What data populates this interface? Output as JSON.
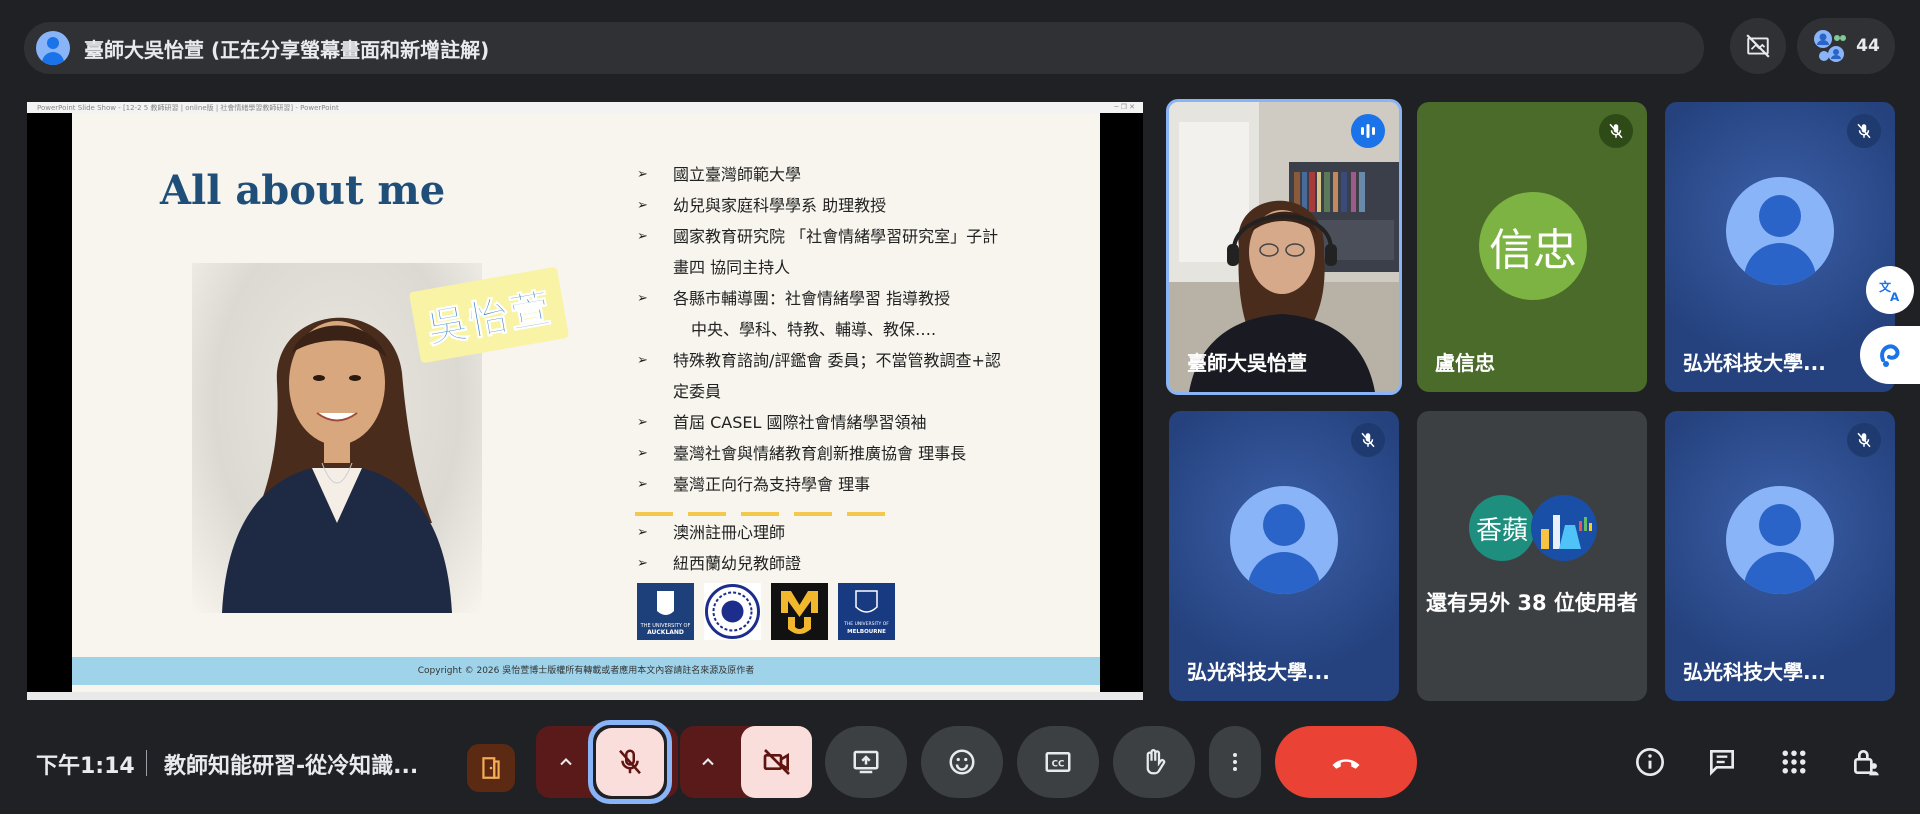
{
  "topbar": {
    "presenter_title": "臺師大吳怡萱 (正在分享螢幕畫面和新增註解)",
    "participant_count": "44"
  },
  "slide": {
    "window_title": "PowerPoint Slide Show - [12-2 5 教師研習 | online版 | 社會情緒學習教師研習] - PowerPoint",
    "heading": "All about me",
    "name_tag": "吳怡萱",
    "bullets": [
      "國立臺灣師範大學",
      "幼兒與家庭科學學系  助理教授",
      "國家教育研究院 「社會情緒學習研究室」子計",
      "畫四 協同主持人",
      "各縣市輔導團：社會情緒學習 指導教授",
      "中央、學科、特教、輔導、教保….",
      "特殊教育諮詢/評鑑會 委員；不當管教調查+認",
      "定委員",
      "首屆 CASEL 國際社會情緒學習領袖",
      "臺灣社會與情緒教育創新推廣協會 理事長",
      "臺灣正向行為支持學會 理事"
    ],
    "bullets2": [
      "澳洲註冊心理師",
      "紐西蘭幼兒教師證"
    ],
    "logos": [
      "THE UNIVERSITY OF AUCKLAND",
      "NTNU",
      "M",
      "THE UNIVERSITY OF MELBOURNE"
    ],
    "footer": "Copyright © 2026 吳怡萱博士版權所有轉載或者應用本文內容請註名來源及原作者"
  },
  "tiles": [
    {
      "name": "臺師大吳怡萱",
      "status": "speaking"
    },
    {
      "name": "盧信忠",
      "initials": "信忠",
      "status": "muted"
    },
    {
      "name": "弘光科技大學...",
      "status": "muted"
    },
    {
      "name": "弘光科技大學...",
      "status": "muted"
    },
    {
      "name": "還有另外 38 位使用者",
      "mini_avatar": "香蘋"
    },
    {
      "name": "弘光科技大學...",
      "status": "muted"
    }
  ],
  "bottombar": {
    "time": "下午1:14",
    "meeting_title": "教師知能研習-從冷知識..."
  },
  "icons": {
    "end_call_color": "#ea4335",
    "mic_off_color": "#f9dedc",
    "focus_ring": "#8ab4f8"
  }
}
